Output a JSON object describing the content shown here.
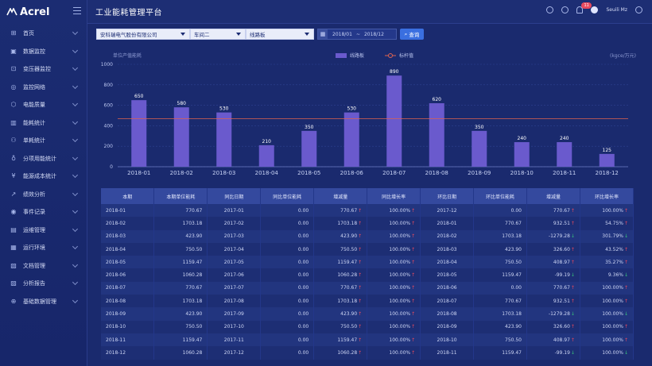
{
  "app": {
    "logo_text": "Acrel",
    "title": "工业能耗管理平台"
  },
  "topbar": {
    "badge": "11",
    "user": "Seuili Mz"
  },
  "sidebar": {
    "items": [
      {
        "label": "首页",
        "icon": "home-icon",
        "glyph": "⊞"
      },
      {
        "label": "数据监控",
        "icon": "monitor-icon",
        "glyph": "▣"
      },
      {
        "label": "变压器监控",
        "icon": "transformer-icon",
        "glyph": "⊡"
      },
      {
        "label": "监控网络",
        "icon": "network-icon",
        "glyph": "◎"
      },
      {
        "label": "电能质量",
        "icon": "power-quality-icon",
        "glyph": "⬡"
      },
      {
        "label": "能耗统计",
        "icon": "bar-chart-icon",
        "glyph": "▥"
      },
      {
        "label": "单耗统计",
        "icon": "unit-consumption-icon",
        "glyph": "⚇"
      },
      {
        "label": "分项用能统计",
        "icon": "bulb-icon",
        "glyph": "♁"
      },
      {
        "label": "能源成本统计",
        "icon": "cost-icon",
        "glyph": "¥"
      },
      {
        "label": "绩效分析",
        "icon": "trend-icon",
        "glyph": "↗"
      },
      {
        "label": "事件记录",
        "icon": "event-icon",
        "glyph": "◉"
      },
      {
        "label": "运维管理",
        "icon": "maintenance-icon",
        "glyph": "▤"
      },
      {
        "label": "运行环境",
        "icon": "environment-icon",
        "glyph": "▦"
      },
      {
        "label": "文档管理",
        "icon": "document-icon",
        "glyph": "▧"
      },
      {
        "label": "分析报告",
        "icon": "report-icon",
        "glyph": "▨"
      },
      {
        "label": "基础数据管理",
        "icon": "database-icon",
        "glyph": "⊕"
      }
    ]
  },
  "filters": {
    "company": "安科瑞电气股份有限公司",
    "workshop": "车间二",
    "line": "线路板",
    "date_start": "2018/01",
    "date_end": "2018/12",
    "date_sep": "~",
    "query_label": "查询"
  },
  "chart_data": {
    "type": "bar",
    "title": "单位产值能耗",
    "unit": "(kgce/万元)",
    "categories": [
      "2018-01",
      "2018-02",
      "2018-03",
      "2018-04",
      "2018-05",
      "2018-06",
      "2018-07",
      "2018-08",
      "2018-09",
      "2018-10",
      "2018-11",
      "2018-12"
    ],
    "series": [
      {
        "name": "线路板",
        "values": [
          650,
          580,
          530,
          210,
          350,
          530,
          890,
          620,
          350,
          240,
          240,
          125
        ],
        "color": "#6a5acd"
      }
    ],
    "benchmark": {
      "name": "标杆值",
      "value": 470,
      "color": "#e0634f"
    },
    "ylim": [
      0,
      1000
    ],
    "yticks": [
      0,
      200,
      400,
      600,
      800,
      1000
    ],
    "legend_position": "top-center"
  },
  "table": {
    "headers": [
      "本期",
      "本期单位能耗",
      "同比日期",
      "同比单位能耗",
      "增减量",
      "同比增长率",
      "环比日期",
      "环比单位能耗",
      "增减量",
      "环比增长率"
    ],
    "rows": [
      [
        "2018-01",
        "770.67",
        "2017-01",
        "0.00",
        "770.67",
        "100.00%",
        "2017-12",
        "0.00",
        "770.67",
        "100.00%"
      ],
      [
        "2018-02",
        "1703.18",
        "2017-02",
        "0.00",
        "1703.18",
        "100.00%",
        "2018-01",
        "770.67",
        "932.51",
        "54.75%"
      ],
      [
        "2018-03",
        "423.90",
        "2017-03",
        "0.00",
        "423.90",
        "100.00%",
        "2018-02",
        "1703.18",
        "-1279.28",
        "301.79%"
      ],
      [
        "2018-04",
        "750.50",
        "2017-04",
        "0.00",
        "750.50",
        "100.00%",
        "2018-03",
        "423.90",
        "326.60",
        "43.52%"
      ],
      [
        "2018-05",
        "1159.47",
        "2017-05",
        "0.00",
        "1159.47",
        "100.00%",
        "2018-04",
        "750.50",
        "408.97",
        "35.27%"
      ],
      [
        "2018-06",
        "1060.28",
        "2017-06",
        "0.00",
        "1060.28",
        "100.00%",
        "2018-05",
        "1159.47",
        "-99.19",
        "9.36%"
      ],
      [
        "2018-07",
        "770.67",
        "2017-07",
        "0.00",
        "770.67",
        "100.00%",
        "2018-06",
        "0.00",
        "770.67",
        "100.00%"
      ],
      [
        "2018-08",
        "1703.18",
        "2017-08",
        "0.00",
        "1703.18",
        "100.00%",
        "2018-07",
        "770.67",
        "932.51",
        "100.00%"
      ],
      [
        "2018-09",
        "423.90",
        "2017-09",
        "0.00",
        "423.90",
        "100.00%",
        "2018-08",
        "1703.18",
        "-1279.28",
        "100.00%"
      ],
      [
        "2018-10",
        "750.50",
        "2017-10",
        "0.00",
        "750.50",
        "100.00%",
        "2018-09",
        "423.90",
        "326.60",
        "100.00%"
      ],
      [
        "2018-11",
        "1159.47",
        "2017-11",
        "0.00",
        "1159.47",
        "100.00%",
        "2018-10",
        "750.50",
        "408.97",
        "100.00%"
      ],
      [
        "2018-12",
        "1060.28",
        "2017-12",
        "0.00",
        "1060.28",
        "100.00%",
        "2018-11",
        "1159.47",
        "-99.19",
        "100.00%"
      ]
    ],
    "mom_dirs": [
      "up",
      "up",
      "down",
      "up",
      "up",
      "down",
      "up",
      "up",
      "down",
      "up",
      "up",
      "down"
    ]
  }
}
